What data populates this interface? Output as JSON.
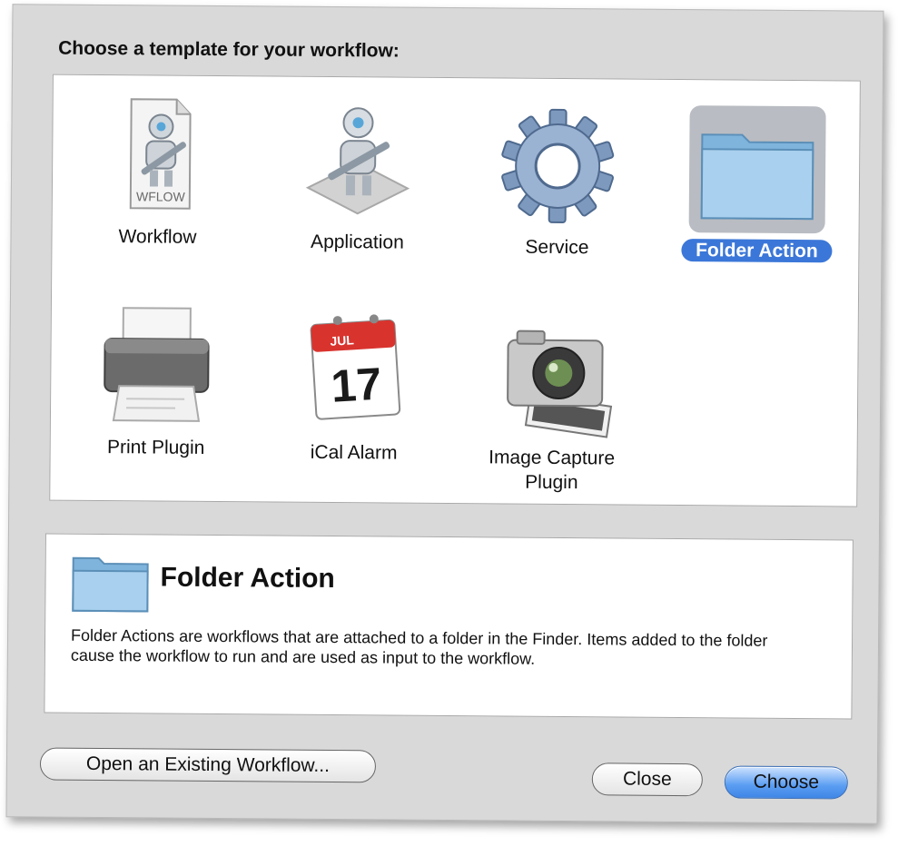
{
  "dialog": {
    "prompt": "Choose a template for your workflow:",
    "templates": [
      {
        "label": "Workflow",
        "icon": "workflow-document-icon",
        "badge": "WFLOW"
      },
      {
        "label": "Application",
        "icon": "automator-robot-icon"
      },
      {
        "label": "Service",
        "icon": "gear-icon"
      },
      {
        "label": "Folder Action",
        "icon": "folder-icon",
        "selected": true
      },
      {
        "label": "Print Plugin",
        "icon": "printer-icon"
      },
      {
        "label": "iCal Alarm",
        "icon": "ical-calendar-icon",
        "month": "JUL",
        "day": "17"
      },
      {
        "label": "Image Capture Plugin",
        "icon": "camera-icon"
      }
    ],
    "info": {
      "title": "Folder Action",
      "description": "Folder Actions are workflows that are attached to a folder in the Finder. Items added to the folder cause the workflow to run and are used as input to the workflow."
    },
    "buttons": {
      "open_existing": "Open an Existing Workflow...",
      "close": "Close",
      "choose": "Choose"
    }
  },
  "colors": {
    "selection": "#3b77d8",
    "folder": "#8fc1e6",
    "sheet": "#d9d9d9"
  }
}
